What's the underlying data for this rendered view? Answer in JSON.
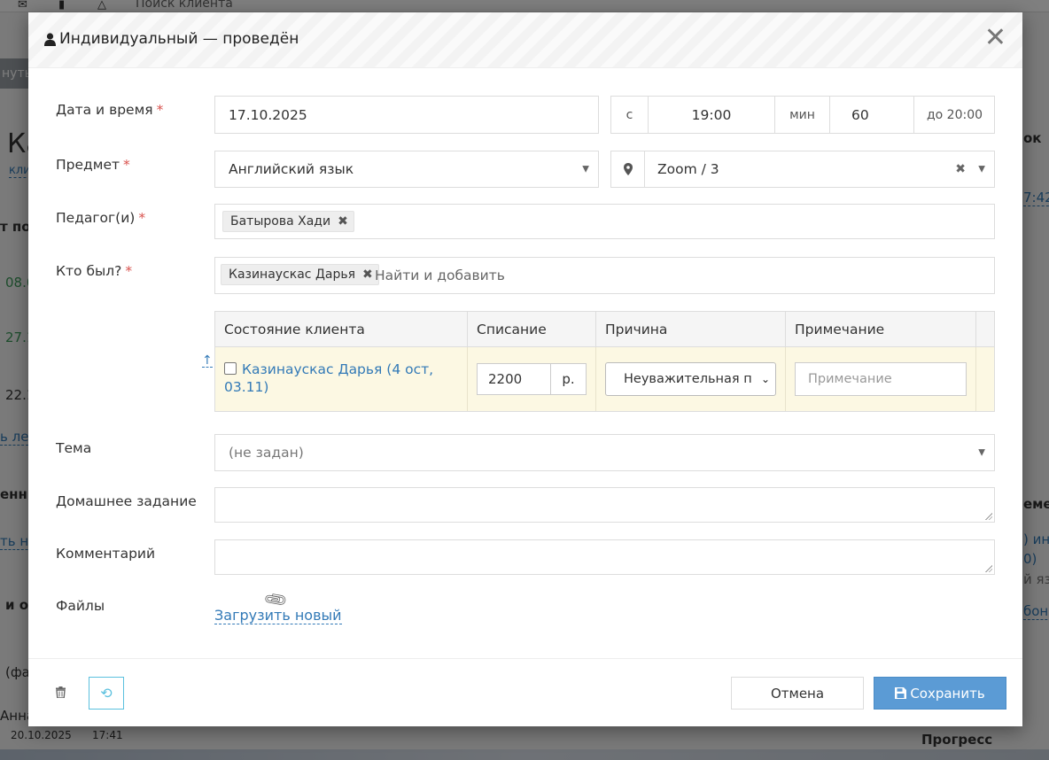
{
  "background": {
    "search_placeholder": "Поиск клиента",
    "btn_partial": "нуть",
    "left_texts": {
      "k": "Ка",
      "kli": "кли",
      "posl": "т пос",
      "d1": "08.0",
      "d2": "27.1",
      "d3": "22.1",
      "lnk1": "ь ле",
      "enn": "енн",
      "lnk2": "ть но",
      "io": "и о",
      "fa": "(фа",
      "anna": "Анна",
      "date": "20.10.2025",
      "time": "17:41"
    },
    "right_texts": {
      "ok": "ок",
      "t742": "7:42",
      "eme": "еме",
      "ind": ") инд",
      "paren": "0)",
      "yaz": "й язы",
      "bone": "боне",
      "progress": "Прогресс"
    }
  },
  "modal": {
    "title": "Индивидуальный — проведён",
    "close": "✕"
  },
  "form": {
    "datetime": {
      "label": "Дата и время",
      "date": "17.10.2025",
      "from_prefix": "с",
      "time": "19:00",
      "duration_unit": "мин",
      "duration": "60",
      "until": "до 20:00"
    },
    "subject": {
      "label": "Предмет",
      "value": "Английский язык",
      "room": "Zoom / 3"
    },
    "teachers": {
      "label": "Педагог(и)",
      "items": [
        "Батырова Хади"
      ]
    },
    "attendees": {
      "label": "Кто был?",
      "items": [
        "Казинаускас Дарья"
      ],
      "placeholder": "Найти и добавить"
    },
    "table": {
      "headers": [
        "Состояние клиента",
        "Списание",
        "Причина",
        "Примечание"
      ],
      "rows": [
        {
          "client": "Казинаускас Дарья (4 ост, 03.11)",
          "charge": "2200",
          "currency": "р.",
          "reason": "Неуважительная п",
          "note_placeholder": "Примечание"
        }
      ]
    },
    "topic": {
      "label": "Тема",
      "value": "(не задан)"
    },
    "homework": {
      "label": "Домашнее задание",
      "value": ""
    },
    "comment": {
      "label": "Комментарий",
      "value": ""
    },
    "files": {
      "label": "Файлы",
      "upload": "Загрузить новый"
    }
  },
  "footer": {
    "cancel": "Отмена",
    "save": "Сохранить"
  },
  "required_mark": "*",
  "colors": {
    "link": "#337ab7",
    "required": "#d9534f",
    "row_highlight": "#fcf8e3",
    "save": "#5b9bd5",
    "history": "#5bc0de"
  }
}
